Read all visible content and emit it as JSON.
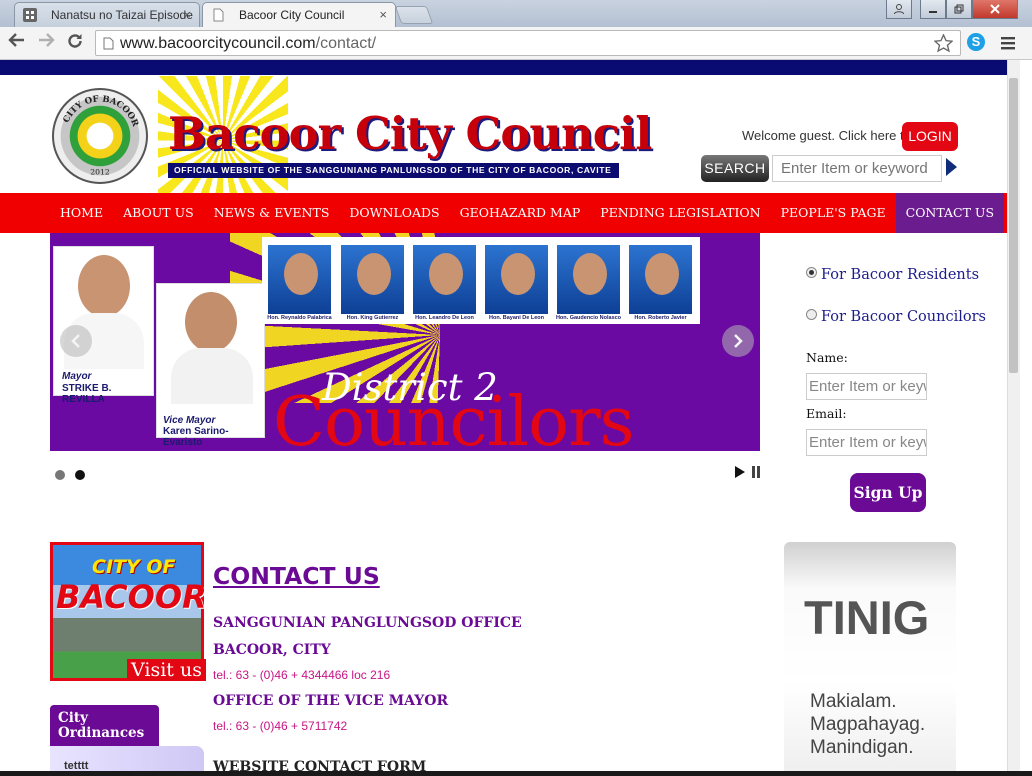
{
  "browser": {
    "tabs": [
      {
        "label": "Nanatsu no Taizai Episode"
      },
      {
        "label": "Bacoor City Council"
      }
    ],
    "url_domain": "www.bacoorcitycouncil.com",
    "url_path": "/contact/",
    "close_glyph": "×"
  },
  "header": {
    "site_title": "Bacoor City Council",
    "subtitle": "OFFICIAL WEBSITE OF THE SANGGUNIANG PANLUNGSOD OF THE CITY OF BACOOR, CAVITE",
    "seal_text": "CITY OF BACOOR",
    "seal_year": "2012",
    "welcome": "Welcome guest. Click here to",
    "login_label": "LOGIN",
    "search_label": "SEARCH",
    "search_placeholder": "Enter Item or keyword"
  },
  "nav": {
    "items": [
      "HOME",
      "ABOUT US",
      "NEWS & EVENTS",
      "DOWNLOADS",
      "GEOHAZARD MAP",
      "PENDING LEGISLATION",
      "PEOPLE'S PAGE",
      "CONTACT US"
    ],
    "active_index": 7
  },
  "banner": {
    "mayor_role": "Mayor",
    "mayor_name": "STRIKE B. REVILLA",
    "vice_role": "Vice Mayor",
    "vice_name": "Karen Sarino-Evaristo",
    "councilors": [
      "Hon. Reynaldo Palabrica",
      "Hon. King Gutierrez",
      "Hon. Leandro De Leon",
      "Hon. Bayani De Leon",
      "Hon. Gaudencio Nolasco",
      "Hon. Roberto Javier"
    ],
    "district_text": "District 2",
    "councilors_text": "Councilors",
    "slide_count": 2,
    "active_slide": 2
  },
  "subscribe": {
    "options": [
      "For Bacoor Residents",
      "For Bacoor Councilors"
    ],
    "selected": 0,
    "name_label": "Name:",
    "email_label": "Email:",
    "input_placeholder": "Enter Item or keyword",
    "signup_label": "Sign Up"
  },
  "visit": {
    "logo_small": "CITY OF",
    "logo_big": "BACOOR",
    "label": "Visit us"
  },
  "ordinances": {
    "tab_label": "City Ordinances",
    "first_item": "tetttt"
  },
  "contact": {
    "heading": "CONTACT US",
    "office1": "SANGGUNIAN PANGLUNGSOD OFFICE",
    "office1_city": "BACOOR, CITY",
    "office1_tel": "tel.: 63 - (0)46 + 4344466 loc 216",
    "office2": "OFFICE OF THE VICE MAYOR",
    "office2_tel": "tel.: 63 - (0)46 + 5711742",
    "form_heading": "WEBSITE CONTACT FORM"
  },
  "tinig": {
    "title": "TINIG",
    "lines": [
      "Makialam.",
      "Magpahayag.",
      "Manindigan."
    ]
  },
  "colors": {
    "nav_red": "#f00000",
    "purple": "#6a0a95",
    "navy": "#0a0a73"
  }
}
